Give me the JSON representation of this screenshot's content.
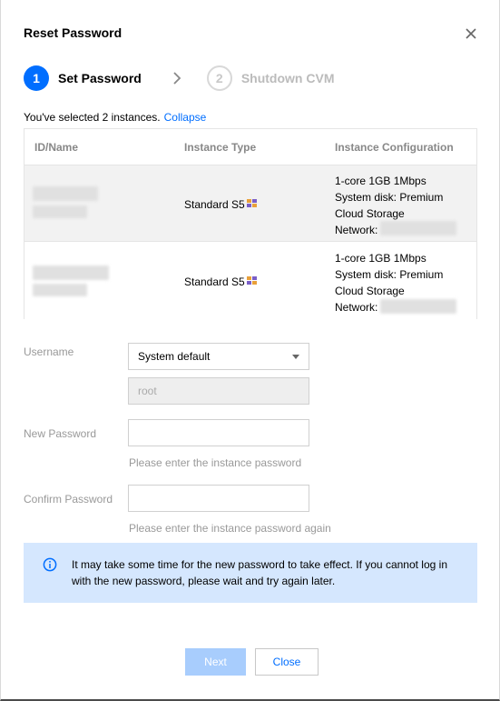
{
  "dialog": {
    "title": "Reset Password"
  },
  "steps": [
    {
      "number": "1",
      "label": "Set Password",
      "state": "active"
    },
    {
      "number": "2",
      "label": "Shutdown CVM",
      "state": "inactive"
    }
  ],
  "selection": {
    "text": "You've selected 2 instances.",
    "collapse_link": "Collapse"
  },
  "instances": {
    "columns": [
      "ID/Name",
      "Instance Type",
      "Instance Configuration"
    ],
    "rows": [
      {
        "type": "Standard S5",
        "config": [
          "1-core 1GB 1Mbps",
          "System disk: Premium",
          "Cloud Storage",
          "Network:"
        ]
      },
      {
        "type": "Standard S5",
        "config": [
          "1-core 1GB 1Mbps",
          "System disk: Premium",
          "Cloud Storage",
          "Network:"
        ]
      }
    ]
  },
  "form": {
    "username_label": "Username",
    "username_select": "System default",
    "username_value": "root",
    "new_password_label": "New Password",
    "new_password_hint": "Please enter the instance password",
    "confirm_password_label": "Confirm Password",
    "confirm_password_hint": "Please enter the instance password again"
  },
  "notice": {
    "message": "It may take some time for the new password to take effect. If you cannot log in with the new password, please wait and try again later."
  },
  "buttons": {
    "next": "Next",
    "close": "Close"
  },
  "colors": {
    "primary": "#006eff",
    "disabled_primary": "#a8cdfd",
    "notice_bg": "#d5e7fe"
  }
}
